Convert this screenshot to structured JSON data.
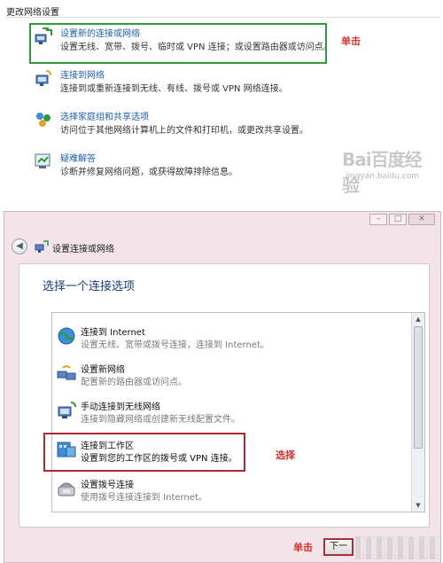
{
  "top": {
    "section_title": "更改网络设置",
    "tasks": [
      {
        "link": "设置新的连接或网络",
        "desc": "设置无线、宽带、拨号、临时或 VPN 连接；或设置路由器或访问点。"
      },
      {
        "link": "连接到网络",
        "desc": "连接到或重新连接到无线、有线、拨号或 VPN 网络连接。"
      },
      {
        "link": "选择家庭组和共享选项",
        "desc": "访问位于其他网络计算机上的文件和打印机，或更改共享设置。"
      },
      {
        "link": "疑难解答",
        "desc": "诊断并修复网络问题，或获得故障排除信息。"
      }
    ],
    "annotation": "单击",
    "watermark": "Bai百度经验",
    "watermark_url": "jingyan.baidu.com"
  },
  "wizard": {
    "title": "设置连接或网络",
    "heading": "选择一个连接选项",
    "options": [
      {
        "title": "连接到 Internet",
        "desc": "设置无线、宽带或拨号连接，连接到 Internet。"
      },
      {
        "title": "设置新网络",
        "desc": "配置新的路由器或访问点。"
      },
      {
        "title": "手动连接到无线网络",
        "desc": "连接到隐藏网络或创建新无线配置文件。"
      },
      {
        "title": "连接到工作区",
        "desc": "设置到您的工作区的拨号或 VPN 连接。"
      },
      {
        "title": "设置拨号连接",
        "desc": "使用拨号连接连接到 Internet。"
      }
    ],
    "select_annotation": "选择",
    "click_annotation": "单击",
    "next_label": "下一"
  },
  "colors": {
    "link": "#1f5fa6",
    "green_highlight": "#2f9a3c",
    "red_highlight": "#b3262f",
    "annotation_red": "#d2322d"
  }
}
